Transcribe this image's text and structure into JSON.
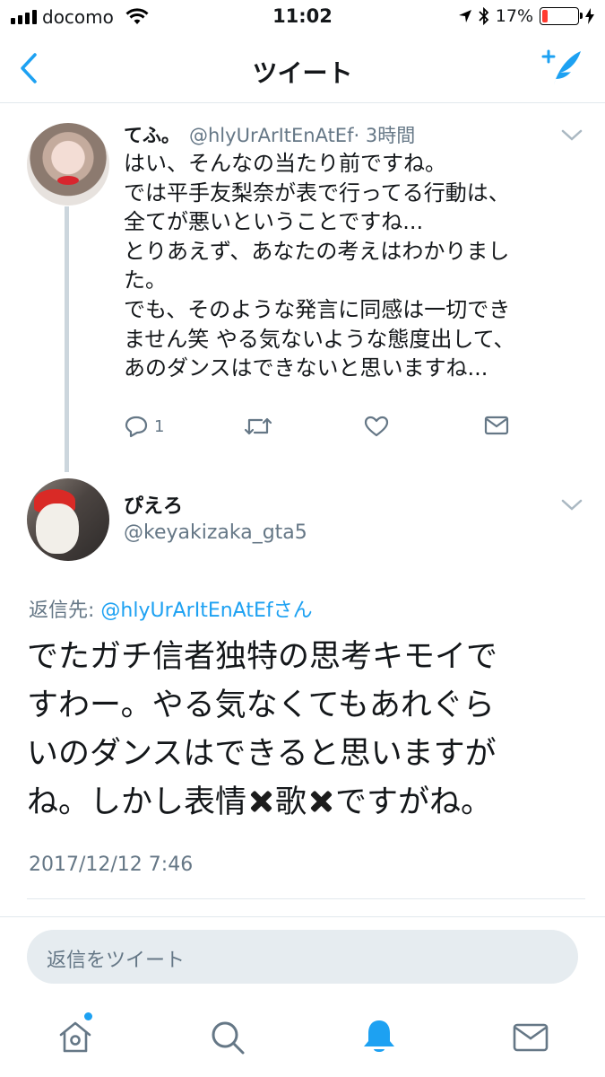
{
  "status_bar": {
    "carrier": "docomo",
    "time": "11:02",
    "battery_percent": "17%",
    "battery_level": 0.17
  },
  "nav": {
    "title": "ツイート"
  },
  "tweet1": {
    "name": "てふ。",
    "handle": "@hlyUrArItEnAtEf",
    "time": "· 3時間",
    "lines": [
      "はい、そんなの当たり前ですね。",
      "では平手友梨奈が表で行ってる行動は、",
      "全てが悪いということですね...",
      "とりあえず、あなたの考えはわかりまし",
      "た。",
      "でも、そのような発言に同感は一切でき",
      "ません笑 やる気ないような態度出して、",
      "あのダンスはできないと思いますね..."
    ],
    "reply_count": "1"
  },
  "tweet2": {
    "name": "ぴえろ",
    "handle": "@keyakizaka_gta5",
    "reply_prefix": "返信先: ",
    "reply_handle": "@hlyUrArItEnAtEf",
    "reply_suffix": "さん",
    "line1": "でたガチ信者独特の思考キモイで",
    "line2": "すわー。やる気なくてもあれぐら",
    "line3": "いのダンスはできると思いますが",
    "line4_a": "ね。しかし表情",
    "line4_b": "歌",
    "line4_c": "ですがね。",
    "timestamp": "2017/12/12 7:46"
  },
  "reply_box": {
    "placeholder": "返信をツイート"
  },
  "colors": {
    "accent": "#1da1f2",
    "muted": "#657786"
  }
}
